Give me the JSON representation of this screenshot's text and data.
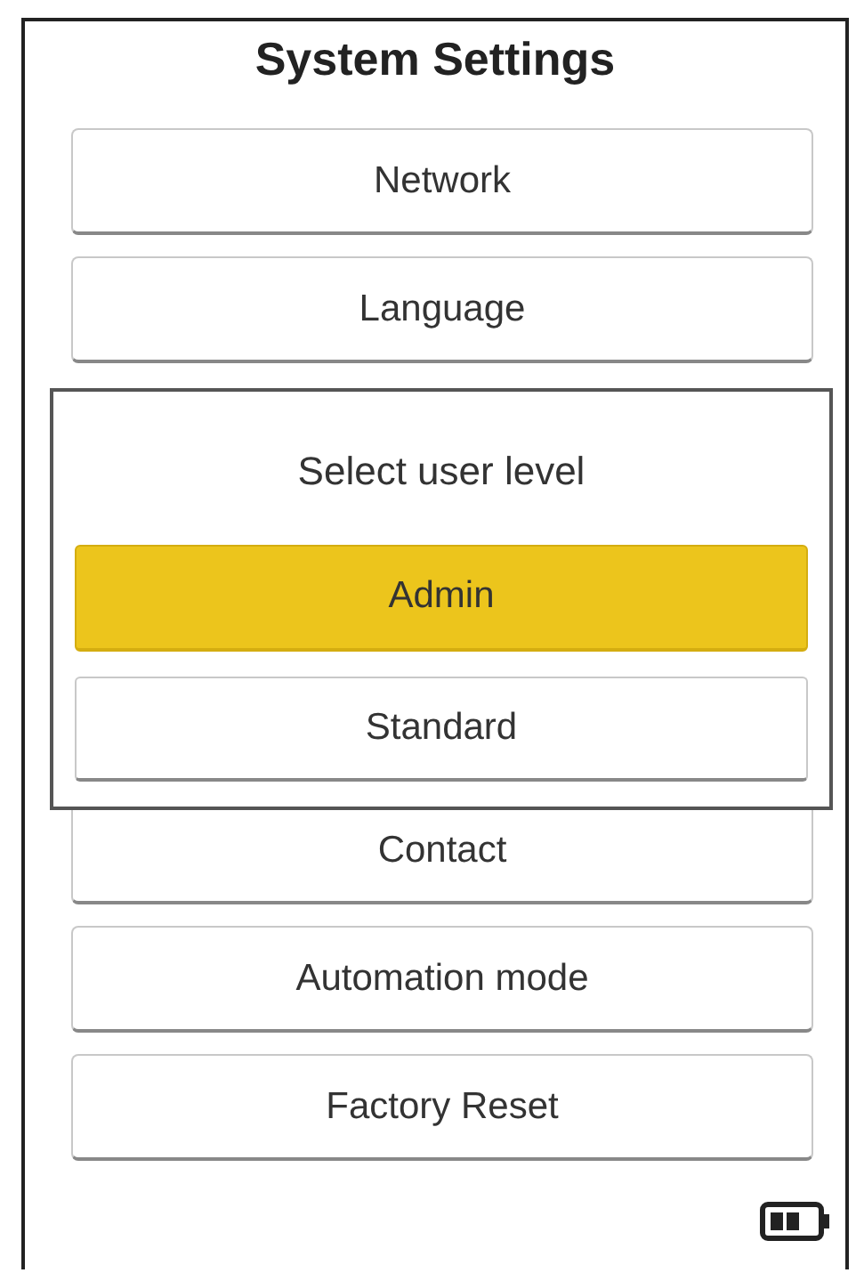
{
  "title": "System Settings",
  "menu_items": [
    {
      "label": "Network"
    },
    {
      "label": "Language"
    },
    {
      "label": "Contact"
    },
    {
      "label": "Automation mode"
    },
    {
      "label": "Factory Reset"
    }
  ],
  "dialog": {
    "title": "Select user level",
    "options": [
      {
        "label": "Admin",
        "selected": true
      },
      {
        "label": "Standard",
        "selected": false
      }
    ]
  }
}
